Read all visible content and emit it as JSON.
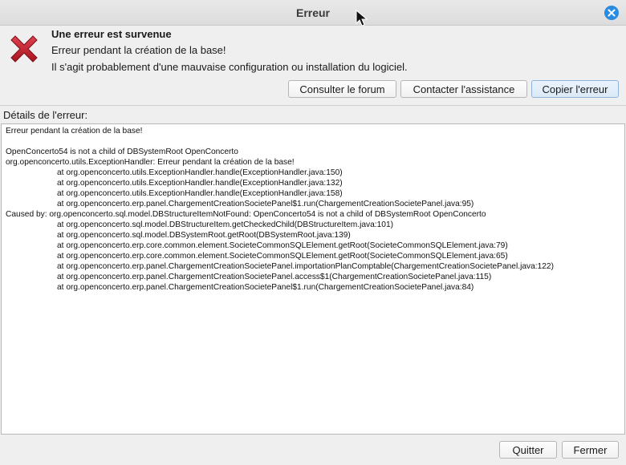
{
  "window": {
    "title": "Erreur"
  },
  "header": {
    "headline": "Une erreur est survenue",
    "message_line1": "Erreur pendant la création de la base!",
    "message_line2": "Il s'agit probablement d'une mauvaise configuration ou installation du logiciel."
  },
  "actions": {
    "forum_label": "Consulter le forum",
    "support_label": "Contacter l'assistance",
    "copy_label": "Copier l'erreur"
  },
  "details": {
    "label": "Détails de l'erreur:",
    "lines": [
      {
        "text": "Erreur pendant la création de la base!",
        "indent": false
      },
      {
        "text": "",
        "indent": false
      },
      {
        "text": "OpenConcerto54 is not a child of DBSystemRoot OpenConcerto",
        "indent": false
      },
      {
        "text": "org.openconcerto.utils.ExceptionHandler: Erreur pendant la création de la base!",
        "indent": false
      },
      {
        "text": "at org.openconcerto.utils.ExceptionHandler.handle(ExceptionHandler.java:150)",
        "indent": true
      },
      {
        "text": "at org.openconcerto.utils.ExceptionHandler.handle(ExceptionHandler.java:132)",
        "indent": true
      },
      {
        "text": "at org.openconcerto.utils.ExceptionHandler.handle(ExceptionHandler.java:158)",
        "indent": true
      },
      {
        "text": "at org.openconcerto.erp.panel.ChargementCreationSocietePanel$1.run(ChargementCreationSocietePanel.java:95)",
        "indent": true
      },
      {
        "text": "Caused by: org.openconcerto.sql.model.DBStructureItemNotFound: OpenConcerto54 is not a child of DBSystemRoot OpenConcerto",
        "indent": false
      },
      {
        "text": "at org.openconcerto.sql.model.DBStructureItem.getCheckedChild(DBStructureItem.java:101)",
        "indent": true
      },
      {
        "text": "at org.openconcerto.sql.model.DBSystemRoot.getRoot(DBSystemRoot.java:139)",
        "indent": true
      },
      {
        "text": "at org.openconcerto.erp.core.common.element.SocieteCommonSQLElement.getRoot(SocieteCommonSQLElement.java:79)",
        "indent": true
      },
      {
        "text": "at org.openconcerto.erp.core.common.element.SocieteCommonSQLElement.getRoot(SocieteCommonSQLElement.java:65)",
        "indent": true
      },
      {
        "text": "at org.openconcerto.erp.panel.ChargementCreationSocietePanel.importationPlanComptable(ChargementCreationSocietePanel.java:122)",
        "indent": true
      },
      {
        "text": "at org.openconcerto.erp.panel.ChargementCreationSocietePanel.access$1(ChargementCreationSocietePanel.java:115)",
        "indent": true
      },
      {
        "text": "at org.openconcerto.erp.panel.ChargementCreationSocietePanel$1.run(ChargementCreationSocietePanel.java:84)",
        "indent": true
      }
    ]
  },
  "footer": {
    "quit_label": "Quitter",
    "close_label": "Fermer"
  },
  "icons": {
    "close": "close-icon",
    "error": "error-x-icon",
    "cursor": "mouse-cursor-icon"
  },
  "colors": {
    "close_button": "#2a8ce0",
    "error_icon": "#c4202f"
  }
}
